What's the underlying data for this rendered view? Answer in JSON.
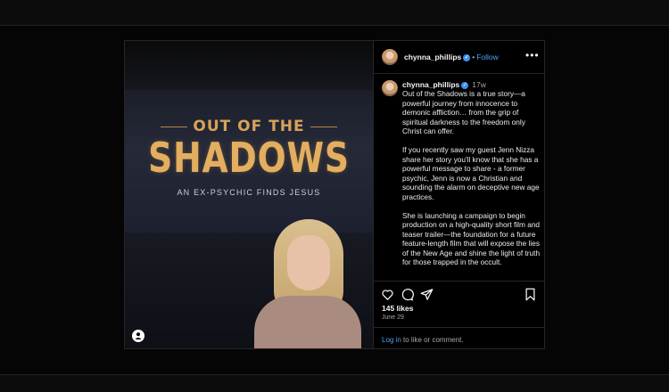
{
  "post": {
    "media": {
      "title_top": "OUT OF THE",
      "title_main": "SHADOWS",
      "subtitle": "AN EX-PSYCHIC FINDS JESUS",
      "user_tag_icon": "person-icon"
    },
    "header": {
      "username": "chynna_phillips",
      "separator": "•",
      "follow_label": "Follow",
      "more_icon": "•••"
    },
    "caption": {
      "username": "chynna_phillips",
      "time_ago": "17w",
      "paragraphs": [
        "Out of the Shadows is a true story—a powerful journey from innocence to demonic affliction… from the grip of spiritual darkness to the freedom only Christ can offer.",
        "If you recently saw my guest Jenn Nizza share her story you'll know that she has a powerful message to share - a former psychic, Jenn is now a Christian and sounding the alarm on deceptive new age practices.",
        "She is launching a campaign to begin production on a high-quality short film and teaser trailer—the foundation for a future feature-length film that will expose the lies of the New Age and shine the light of truth for those trapped in the occult."
      ]
    },
    "actions": {
      "likes": "145 likes",
      "date": "June 29",
      "login_link": "Log in",
      "login_text": " to like or comment."
    }
  },
  "colors": {
    "accent_blue": "#4aa3f6",
    "title_gold": "#e3ae5f",
    "background": "#000000"
  }
}
